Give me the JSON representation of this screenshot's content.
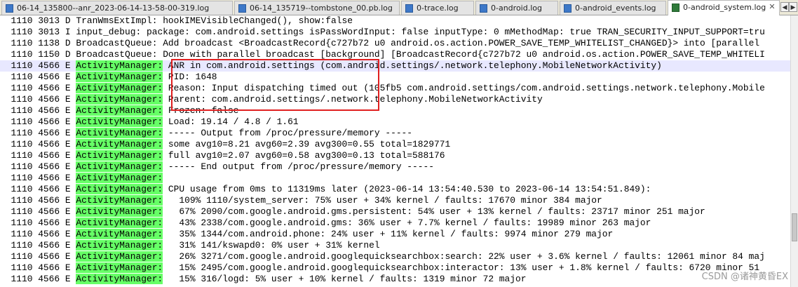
{
  "tabs": [
    {
      "label": "06-14_135800--anr_2023-06-14-13-58-00-319.log",
      "active": false
    },
    {
      "label": "06-14_135719--tombstone_00.pb.log",
      "active": false
    },
    {
      "label": "0-trace.log",
      "active": false
    },
    {
      "label": "0-android.log",
      "active": false
    },
    {
      "label": "0-android_events.log",
      "active": false
    },
    {
      "label": "0-android_system.log",
      "active": true
    }
  ],
  "icons": {
    "file": "log-file-icon",
    "close": "close-icon"
  },
  "colors": {
    "tag_highlight": "#66ff66",
    "annotation_box": "#e02020",
    "current_line": "#e8e8ff"
  },
  "lines": [
    {
      "pid": "1110",
      "tid": "3013",
      "level": "D",
      "tag": "TranWmsExtImpl:",
      "msg": "hookIMEVisibleChanged(), show:false",
      "hl": false
    },
    {
      "pid": "1110",
      "tid": "3013",
      "level": "I",
      "tag": "input_debug:",
      "msg": "package: com.android.settings isPassWordInput: false inputType: 0 mMethodMap: true TRAN_SECURITY_INPUT_SUPPORT=tru",
      "hl": false
    },
    {
      "pid": "1110",
      "tid": "1138",
      "level": "D",
      "tag": "BroadcastQueue:",
      "msg": "Add broadcast <BroadcastRecord{c727b72 u0 android.os.action.POWER_SAVE_TEMP_WHITELIST_CHANGED}> into [parallel",
      "hl": false
    },
    {
      "pid": "1110",
      "tid": "1150",
      "level": "D",
      "tag": "BroadcastQueue:",
      "msg": "Done with parallel broadcast [background] [BroadcastRecord{c727b72 u0 android.os.action.POWER_SAVE_TEMP_WHITELI",
      "hl": false
    },
    {
      "pid": "1110",
      "tid": "4566",
      "level": "E",
      "tag": "ActivityManager:",
      "msg": "ANR in com.android.settings (com.android.settings/.network.telephony.MobileNetworkActivity)",
      "hl": true,
      "current": true
    },
    {
      "pid": "1110",
      "tid": "4566",
      "level": "E",
      "tag": "ActivityManager:",
      "msg": "PID: 1648",
      "hl": true
    },
    {
      "pid": "1110",
      "tid": "4566",
      "level": "E",
      "tag": "ActivityManager:",
      "msg": "Reason: Input dispatching timed out (105fb5 com.android.settings/com.android.settings.network.telephony.Mobile",
      "hl": true
    },
    {
      "pid": "1110",
      "tid": "4566",
      "level": "E",
      "tag": "ActivityManager:",
      "msg": "Parent: com.android.settings/.network.telephony.MobileNetworkActivity",
      "hl": true
    },
    {
      "pid": "1110",
      "tid": "4566",
      "level": "E",
      "tag": "ActivityManager:",
      "msg": "Frozen: false",
      "hl": true
    },
    {
      "pid": "1110",
      "tid": "4566",
      "level": "E",
      "tag": "ActivityManager:",
      "msg": "Load: 19.14 / 4.8 / 1.61",
      "hl": true
    },
    {
      "pid": "1110",
      "tid": "4566",
      "level": "E",
      "tag": "ActivityManager:",
      "msg": "----- Output from /proc/pressure/memory -----",
      "hl": true
    },
    {
      "pid": "1110",
      "tid": "4566",
      "level": "E",
      "tag": "ActivityManager:",
      "msg": "some avg10=8.21 avg60=2.39 avg300=0.55 total=1829771",
      "hl": true
    },
    {
      "pid": "1110",
      "tid": "4566",
      "level": "E",
      "tag": "ActivityManager:",
      "msg": "full avg10=2.07 avg60=0.58 avg300=0.13 total=588176",
      "hl": true
    },
    {
      "pid": "1110",
      "tid": "4566",
      "level": "E",
      "tag": "ActivityManager:",
      "msg": "----- End output from /proc/pressure/memory -----",
      "hl": true
    },
    {
      "pid": "1110",
      "tid": "4566",
      "level": "E",
      "tag": "ActivityManager:",
      "msg": "",
      "hl": true
    },
    {
      "pid": "1110",
      "tid": "4566",
      "level": "E",
      "tag": "ActivityManager:",
      "msg": "CPU usage from 0ms to 11319ms later (2023-06-14 13:54:40.530 to 2023-06-14 13:54:51.849):",
      "hl": true
    },
    {
      "pid": "1110",
      "tid": "4566",
      "level": "E",
      "tag": "ActivityManager:",
      "msg": "  109% 1110/system_server: 75% user + 34% kernel / faults: 17670 minor 384 major",
      "hl": true
    },
    {
      "pid": "1110",
      "tid": "4566",
      "level": "E",
      "tag": "ActivityManager:",
      "msg": "  67% 2090/com.google.android.gms.persistent: 54% user + 13% kernel / faults: 23717 minor 251 major",
      "hl": true
    },
    {
      "pid": "1110",
      "tid": "4566",
      "level": "E",
      "tag": "ActivityManager:",
      "msg": "  43% 2338/com.google.android.gms: 36% user + 7.7% kernel / faults: 19989 minor 263 major",
      "hl": true
    },
    {
      "pid": "1110",
      "tid": "4566",
      "level": "E",
      "tag": "ActivityManager:",
      "msg": "  35% 1344/com.android.phone: 24% user + 11% kernel / faults: 9974 minor 279 major",
      "hl": true
    },
    {
      "pid": "1110",
      "tid": "4566",
      "level": "E",
      "tag": "ActivityManager:",
      "msg": "  31% 141/kswapd0: 0% user + 31% kernel",
      "hl": true
    },
    {
      "pid": "1110",
      "tid": "4566",
      "level": "E",
      "tag": "ActivityManager:",
      "msg": "  26% 3271/com.google.android.googlequicksearchbox:search: 22% user + 3.6% kernel / faults: 12061 minor 84 maj",
      "hl": true
    },
    {
      "pid": "1110",
      "tid": "4566",
      "level": "E",
      "tag": "ActivityManager:",
      "msg": "  15% 2495/com.google.android.googlequicksearchbox:interactor: 13% user + 1.8% kernel / faults: 6720 minor 51",
      "hl": true
    },
    {
      "pid": "1110",
      "tid": "4566",
      "level": "E",
      "tag": "ActivityManager:",
      "msg": "  15% 316/logd: 5% user + 10% kernel / faults: 1319 minor 72 major",
      "hl": true
    }
  ],
  "watermark": "CSDN @诸神黄昏EX"
}
